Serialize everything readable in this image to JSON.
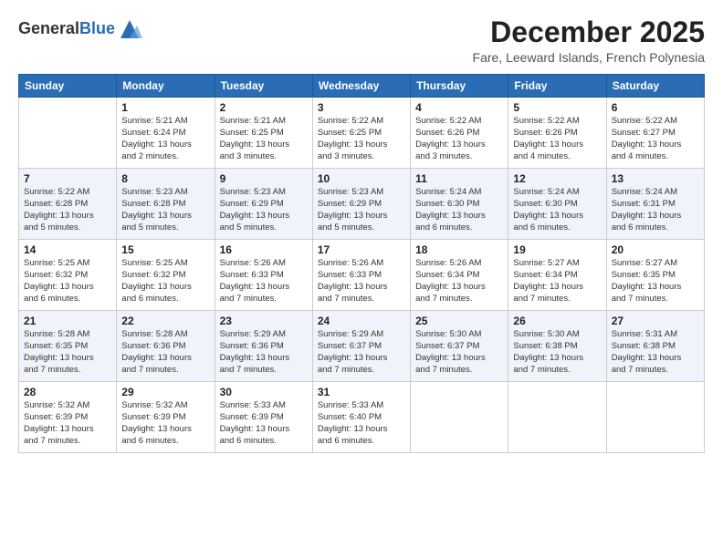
{
  "logo": {
    "general": "General",
    "blue": "Blue"
  },
  "title": "December 2025",
  "subtitle": "Fare, Leeward Islands, French Polynesia",
  "days": [
    "Sunday",
    "Monday",
    "Tuesday",
    "Wednesday",
    "Thursday",
    "Friday",
    "Saturday"
  ],
  "weeks": [
    [
      {
        "num": "",
        "info": ""
      },
      {
        "num": "1",
        "info": "Sunrise: 5:21 AM\nSunset: 6:24 PM\nDaylight: 13 hours\nand 2 minutes."
      },
      {
        "num": "2",
        "info": "Sunrise: 5:21 AM\nSunset: 6:25 PM\nDaylight: 13 hours\nand 3 minutes."
      },
      {
        "num": "3",
        "info": "Sunrise: 5:22 AM\nSunset: 6:25 PM\nDaylight: 13 hours\nand 3 minutes."
      },
      {
        "num": "4",
        "info": "Sunrise: 5:22 AM\nSunset: 6:26 PM\nDaylight: 13 hours\nand 3 minutes."
      },
      {
        "num": "5",
        "info": "Sunrise: 5:22 AM\nSunset: 6:26 PM\nDaylight: 13 hours\nand 4 minutes."
      },
      {
        "num": "6",
        "info": "Sunrise: 5:22 AM\nSunset: 6:27 PM\nDaylight: 13 hours\nand 4 minutes."
      }
    ],
    [
      {
        "num": "7",
        "info": "Sunrise: 5:22 AM\nSunset: 6:28 PM\nDaylight: 13 hours\nand 5 minutes."
      },
      {
        "num": "8",
        "info": "Sunrise: 5:23 AM\nSunset: 6:28 PM\nDaylight: 13 hours\nand 5 minutes."
      },
      {
        "num": "9",
        "info": "Sunrise: 5:23 AM\nSunset: 6:29 PM\nDaylight: 13 hours\nand 5 minutes."
      },
      {
        "num": "10",
        "info": "Sunrise: 5:23 AM\nSunset: 6:29 PM\nDaylight: 13 hours\nand 5 minutes."
      },
      {
        "num": "11",
        "info": "Sunrise: 5:24 AM\nSunset: 6:30 PM\nDaylight: 13 hours\nand 6 minutes."
      },
      {
        "num": "12",
        "info": "Sunrise: 5:24 AM\nSunset: 6:30 PM\nDaylight: 13 hours\nand 6 minutes."
      },
      {
        "num": "13",
        "info": "Sunrise: 5:24 AM\nSunset: 6:31 PM\nDaylight: 13 hours\nand 6 minutes."
      }
    ],
    [
      {
        "num": "14",
        "info": "Sunrise: 5:25 AM\nSunset: 6:32 PM\nDaylight: 13 hours\nand 6 minutes."
      },
      {
        "num": "15",
        "info": "Sunrise: 5:25 AM\nSunset: 6:32 PM\nDaylight: 13 hours\nand 6 minutes."
      },
      {
        "num": "16",
        "info": "Sunrise: 5:26 AM\nSunset: 6:33 PM\nDaylight: 13 hours\nand 7 minutes."
      },
      {
        "num": "17",
        "info": "Sunrise: 5:26 AM\nSunset: 6:33 PM\nDaylight: 13 hours\nand 7 minutes."
      },
      {
        "num": "18",
        "info": "Sunrise: 5:26 AM\nSunset: 6:34 PM\nDaylight: 13 hours\nand 7 minutes."
      },
      {
        "num": "19",
        "info": "Sunrise: 5:27 AM\nSunset: 6:34 PM\nDaylight: 13 hours\nand 7 minutes."
      },
      {
        "num": "20",
        "info": "Sunrise: 5:27 AM\nSunset: 6:35 PM\nDaylight: 13 hours\nand 7 minutes."
      }
    ],
    [
      {
        "num": "21",
        "info": "Sunrise: 5:28 AM\nSunset: 6:35 PM\nDaylight: 13 hours\nand 7 minutes."
      },
      {
        "num": "22",
        "info": "Sunrise: 5:28 AM\nSunset: 6:36 PM\nDaylight: 13 hours\nand 7 minutes."
      },
      {
        "num": "23",
        "info": "Sunrise: 5:29 AM\nSunset: 6:36 PM\nDaylight: 13 hours\nand 7 minutes."
      },
      {
        "num": "24",
        "info": "Sunrise: 5:29 AM\nSunset: 6:37 PM\nDaylight: 13 hours\nand 7 minutes."
      },
      {
        "num": "25",
        "info": "Sunrise: 5:30 AM\nSunset: 6:37 PM\nDaylight: 13 hours\nand 7 minutes."
      },
      {
        "num": "26",
        "info": "Sunrise: 5:30 AM\nSunset: 6:38 PM\nDaylight: 13 hours\nand 7 minutes."
      },
      {
        "num": "27",
        "info": "Sunrise: 5:31 AM\nSunset: 6:38 PM\nDaylight: 13 hours\nand 7 minutes."
      }
    ],
    [
      {
        "num": "28",
        "info": "Sunrise: 5:32 AM\nSunset: 6:39 PM\nDaylight: 13 hours\nand 7 minutes."
      },
      {
        "num": "29",
        "info": "Sunrise: 5:32 AM\nSunset: 6:39 PM\nDaylight: 13 hours\nand 6 minutes."
      },
      {
        "num": "30",
        "info": "Sunrise: 5:33 AM\nSunset: 6:39 PM\nDaylight: 13 hours\nand 6 minutes."
      },
      {
        "num": "31",
        "info": "Sunrise: 5:33 AM\nSunset: 6:40 PM\nDaylight: 13 hours\nand 6 minutes."
      },
      {
        "num": "",
        "info": ""
      },
      {
        "num": "",
        "info": ""
      },
      {
        "num": "",
        "info": ""
      }
    ]
  ]
}
